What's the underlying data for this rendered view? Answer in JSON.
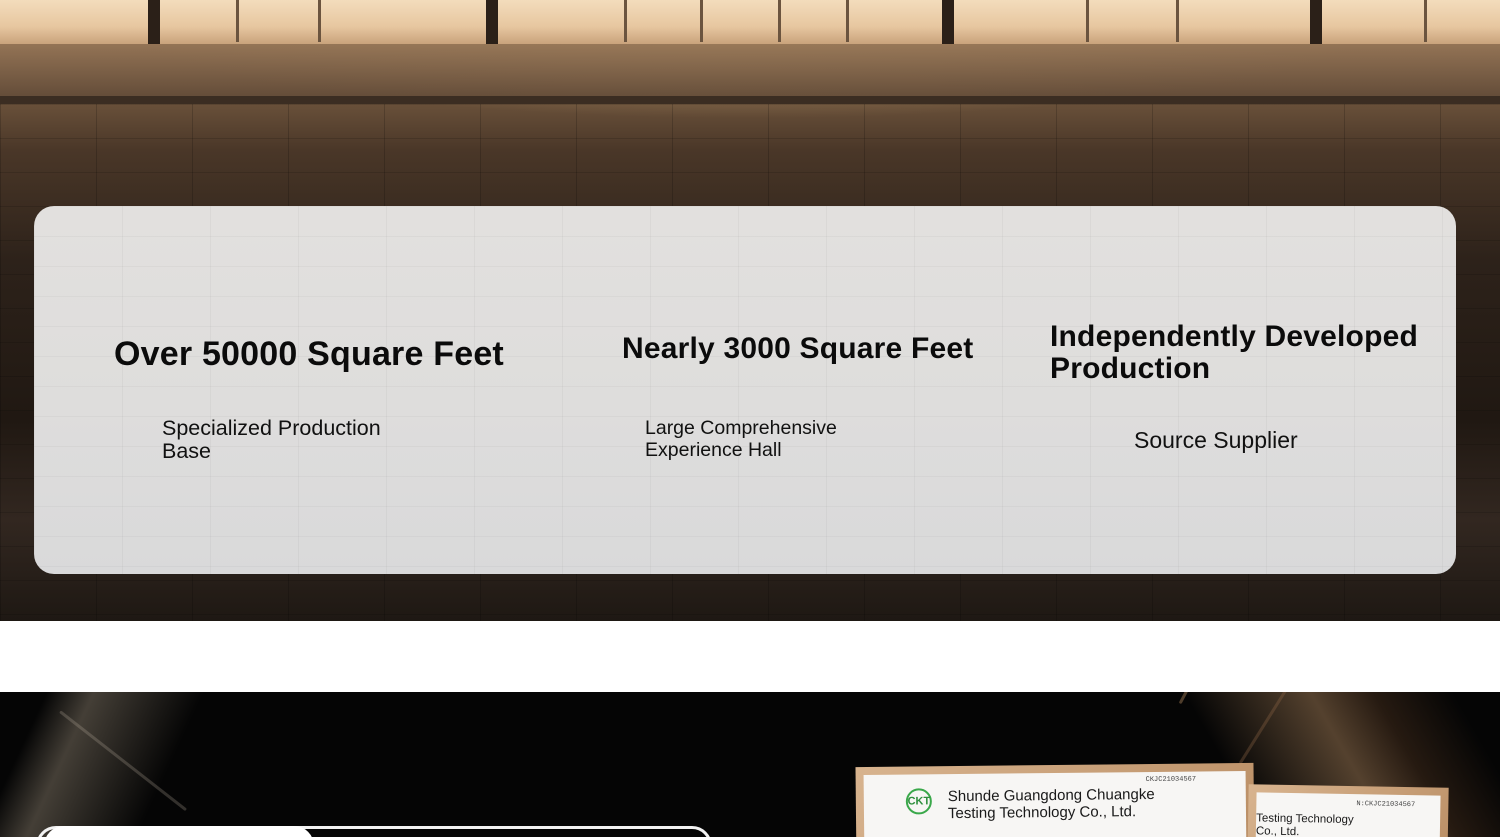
{
  "stats": [
    {
      "title": "Over 50000 Square Feet",
      "subtitle": "Specialized Production Base"
    },
    {
      "title": "Nearly 3000 Square Feet",
      "subtitle": "Large Comprehensive Experience Hall"
    },
    {
      "title": "Independently Developed Production",
      "subtitle": "Source Supplier"
    }
  ],
  "certificates": {
    "main": {
      "company": "Shunde Guangdong Chuangke Testing Technology Co., Ltd.",
      "logo_text": "CKT",
      "serial": "CKJC21034567"
    },
    "secondary": {
      "company": "Testing Technology Co., Ltd.",
      "serial": "N:CKJC21034567"
    }
  },
  "colors": {
    "card_bg": "#dfdedd",
    "text_dark": "#0b0b0b",
    "cert_frame": "#c9a078",
    "logo_green": "#3aa84a"
  },
  "icons": {
    "cert_logo": "ckt-logo-icon"
  }
}
